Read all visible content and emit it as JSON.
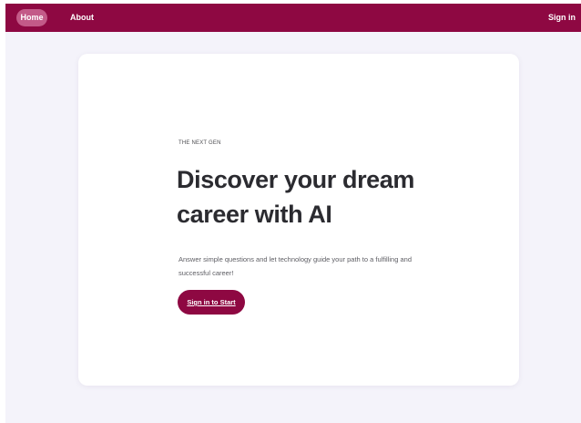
{
  "nav": {
    "home_label": "Home",
    "about_label": "About",
    "signin_label": "Sign in"
  },
  "hero": {
    "eyebrow": "THE NEXT GEN",
    "headline": "Discover your dream career with AI",
    "subtext": "Answer simple questions and let technology guide your path to a fulfilling and successful career!",
    "cta_label": "Sign in to Start"
  },
  "colors": {
    "brand": "#8e0842",
    "background": "#f4f3fa",
    "card": "#ffffff",
    "home_pill": "#c35a88"
  }
}
